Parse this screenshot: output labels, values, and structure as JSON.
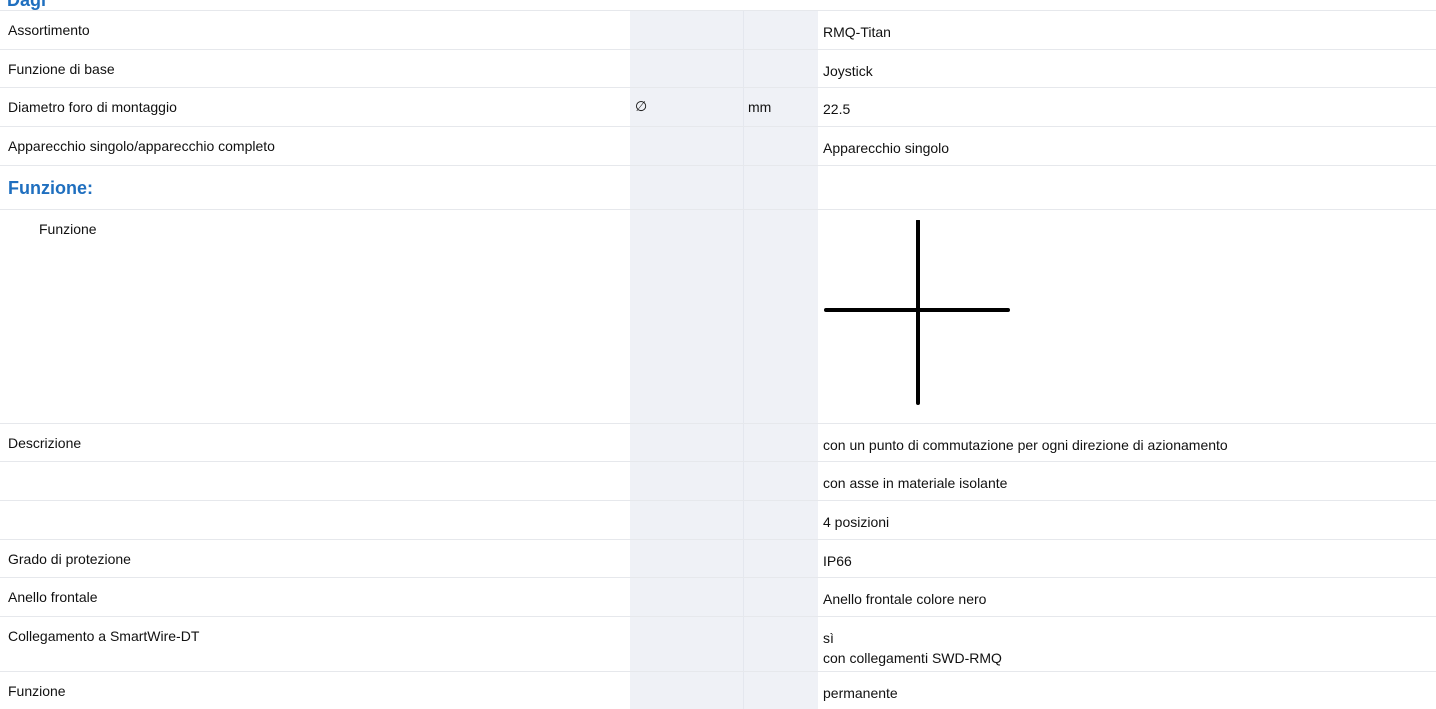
{
  "header": {
    "partial_title": "Dagi"
  },
  "rows": [
    {
      "label": "Assortimento",
      "value": "RMQ-Titan"
    },
    {
      "label": "Funzione di base",
      "value": "Joystick"
    },
    {
      "label": "Diametro foro di montaggio",
      "symbol": "∅",
      "unit": "mm",
      "value": "22.5"
    },
    {
      "label": "Apparecchio singolo/apparecchio completo",
      "value": "Apparecchio singolo"
    }
  ],
  "section": {
    "title": "Funzione:"
  },
  "function_row": {
    "label": "Funzione",
    "symbol_icon": "joystick-cross-symbol"
  },
  "description": {
    "label": "Descrizione",
    "values": [
      "con un punto di commutazione per ogni direzione di azionamento",
      "con asse in materiale isolante",
      "4 posizioni"
    ]
  },
  "rows2": [
    {
      "label": "Grado di protezione",
      "value": "IP66"
    },
    {
      "label": "Anello frontale",
      "value": "Anello frontale colore nero"
    }
  ],
  "smartwire": {
    "label": "Collegamento a SmartWire-DT",
    "value_line1": "sì",
    "value_line2": "con collegamenti SWD-RMQ"
  },
  "last_row": {
    "label": "Funzione",
    "value": "permanente"
  },
  "colors": {
    "accent": "#1f6fbf",
    "column_shade": "#eff1f6",
    "row_border": "#e6e8ec"
  }
}
